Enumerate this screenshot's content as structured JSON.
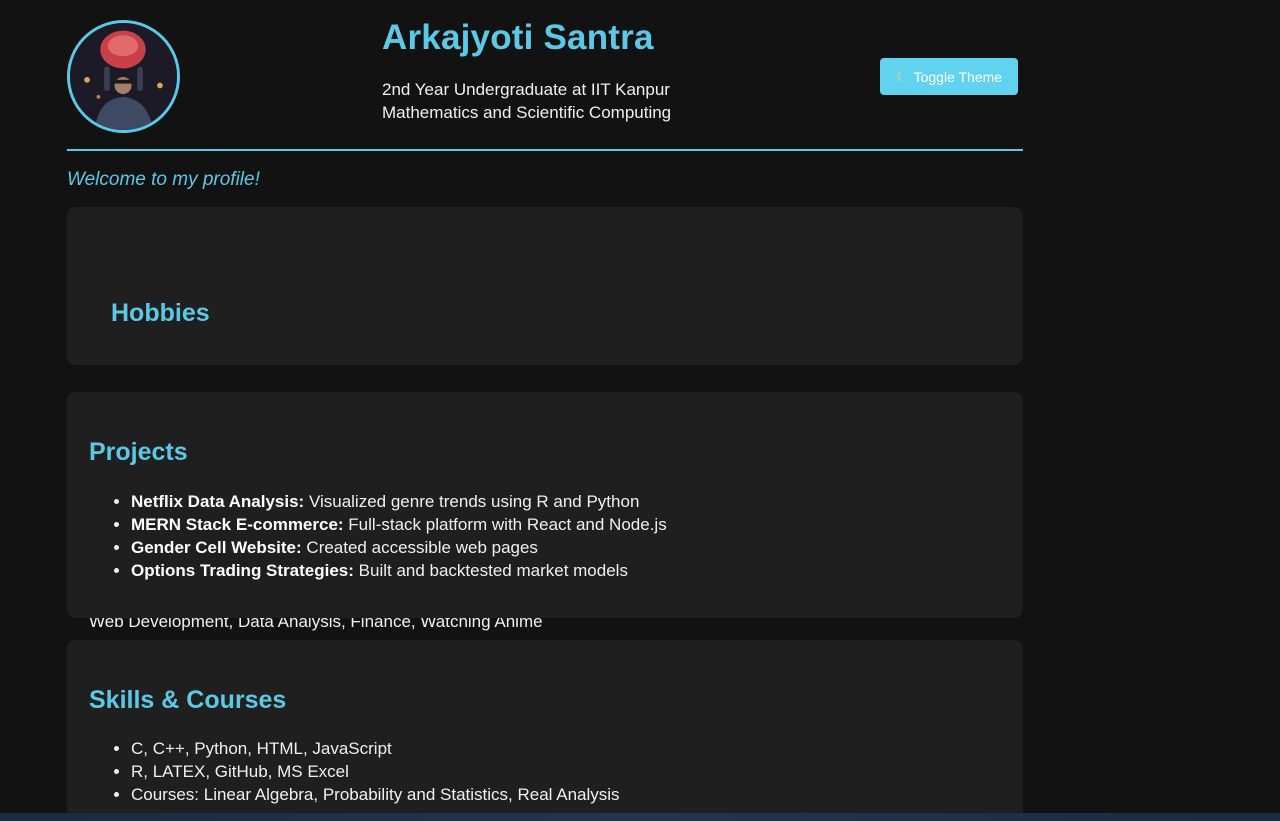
{
  "profile": {
    "name": "Arkajyoti Santra",
    "subtitle_line1": "2nd Year Undergraduate at IIT Kanpur",
    "subtitle_line2": "Mathematics and Scientific Computing",
    "toggle_label": "Toggle Theme",
    "toggle_icon": "crescent-moon-icon"
  },
  "welcome": "Welcome to my profile!",
  "hobbies": {
    "title": "Hobbies",
    "text": "Web Development, Data Analysis, Finance, Watching Anime"
  },
  "projects": {
    "title": "Projects",
    "items": [
      {
        "name": "Netflix Data Analysis:",
        "desc": " Visualized genre trends using R and Python"
      },
      {
        "name": "MERN Stack E-commerce:",
        "desc": " Full-stack platform with React and Node.js"
      },
      {
        "name": "Gender Cell Website:",
        "desc": " Created accessible web pages"
      },
      {
        "name": "Options Trading Strategies:",
        "desc": " Built and backtested market models"
      }
    ]
  },
  "skills": {
    "title": "Skills & Courses",
    "items": [
      "C, C++, Python, HTML, JavaScript",
      "R, LATEX, GitHub, MS Excel",
      "Courses: Linear Algebra, Probability and Statistics, Real Analysis"
    ]
  },
  "colors": {
    "accent": "#5bc8e6",
    "background": "#121212",
    "card": "#1f1f1f",
    "button": "#62d3ee"
  }
}
